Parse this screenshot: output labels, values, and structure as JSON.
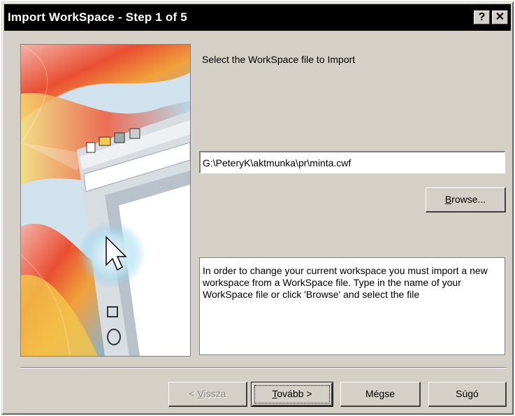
{
  "window": {
    "title": "Import WorkSpace - Step 1 of 5",
    "help_glyph": "?",
    "close_glyph": "✕"
  },
  "main": {
    "instruction": "Select the WorkSpace file to Import",
    "file_path": "G:\\PeteryK\\aktmunka\\pr\\minta.cwf",
    "browse": {
      "mnemonic": "B",
      "rest": "rowse..."
    },
    "description": "In order to change your current workspace you must import a new workspace from a WorkSpace file. Type in the name of your WorkSpace file or click 'Browse' and select the file"
  },
  "buttons": {
    "back": {
      "prefix": "< ",
      "mnemonic": "V",
      "rest": "issza"
    },
    "next": {
      "mnemonic": "T",
      "rest": "ovább >"
    },
    "cancel": "Mégse",
    "help": "Súgó"
  },
  "colors": {
    "dialog_bg": "#d4d0c8",
    "titlebar_bg": "#000000",
    "title_text": "#ffffff"
  },
  "icons": {
    "wizard_image": "wizard-graphic-drawing-tools",
    "titlebar_help": "question-icon",
    "titlebar_close": "close-icon"
  }
}
